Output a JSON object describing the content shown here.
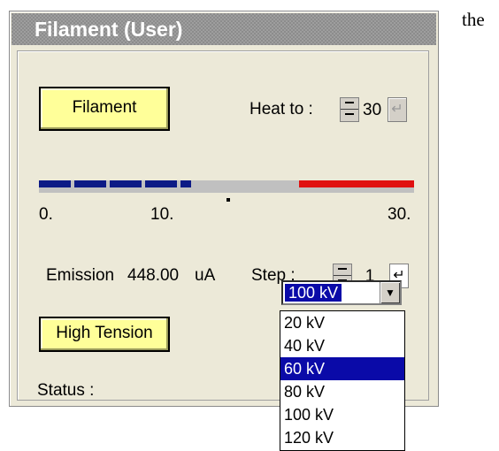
{
  "doc_text": "the",
  "panel": {
    "title": "Filament (User)",
    "filament_button": "Filament",
    "heat_to": {
      "label": "Heat to :",
      "value": "30",
      "enter_glyph": "↵"
    },
    "scale": {
      "tick_labels": [
        "0.",
        "10.",
        "30."
      ],
      "progress_fraction": 0.36
    },
    "emission": {
      "label": "Emission",
      "value": "448.00",
      "unit": "uA"
    },
    "step": {
      "label": "Step :",
      "value": "1",
      "enter_glyph": "↵"
    },
    "high_tension_button": "High Tension",
    "voltage_select": {
      "selected": "100 kV",
      "arrow": "▼",
      "options": [
        "20 kV",
        "40 kV",
        "60 kV",
        "80 kV",
        "100 kV",
        "120 kV"
      ],
      "highlighted": "60 kV"
    },
    "status_label": "Status :"
  },
  "colors": {
    "panel_bg": "#ece9d8",
    "title_bar": "#8c8c8c",
    "button_yellow": "#ffff99",
    "bar_blue": "#0c1a86",
    "bar_red": "#e01010",
    "selection_blue": "#0a0aa8"
  },
  "icons": {
    "spin": "spinner-icon",
    "enter": "enter-icon",
    "dropdown": "chevron-down-icon"
  }
}
